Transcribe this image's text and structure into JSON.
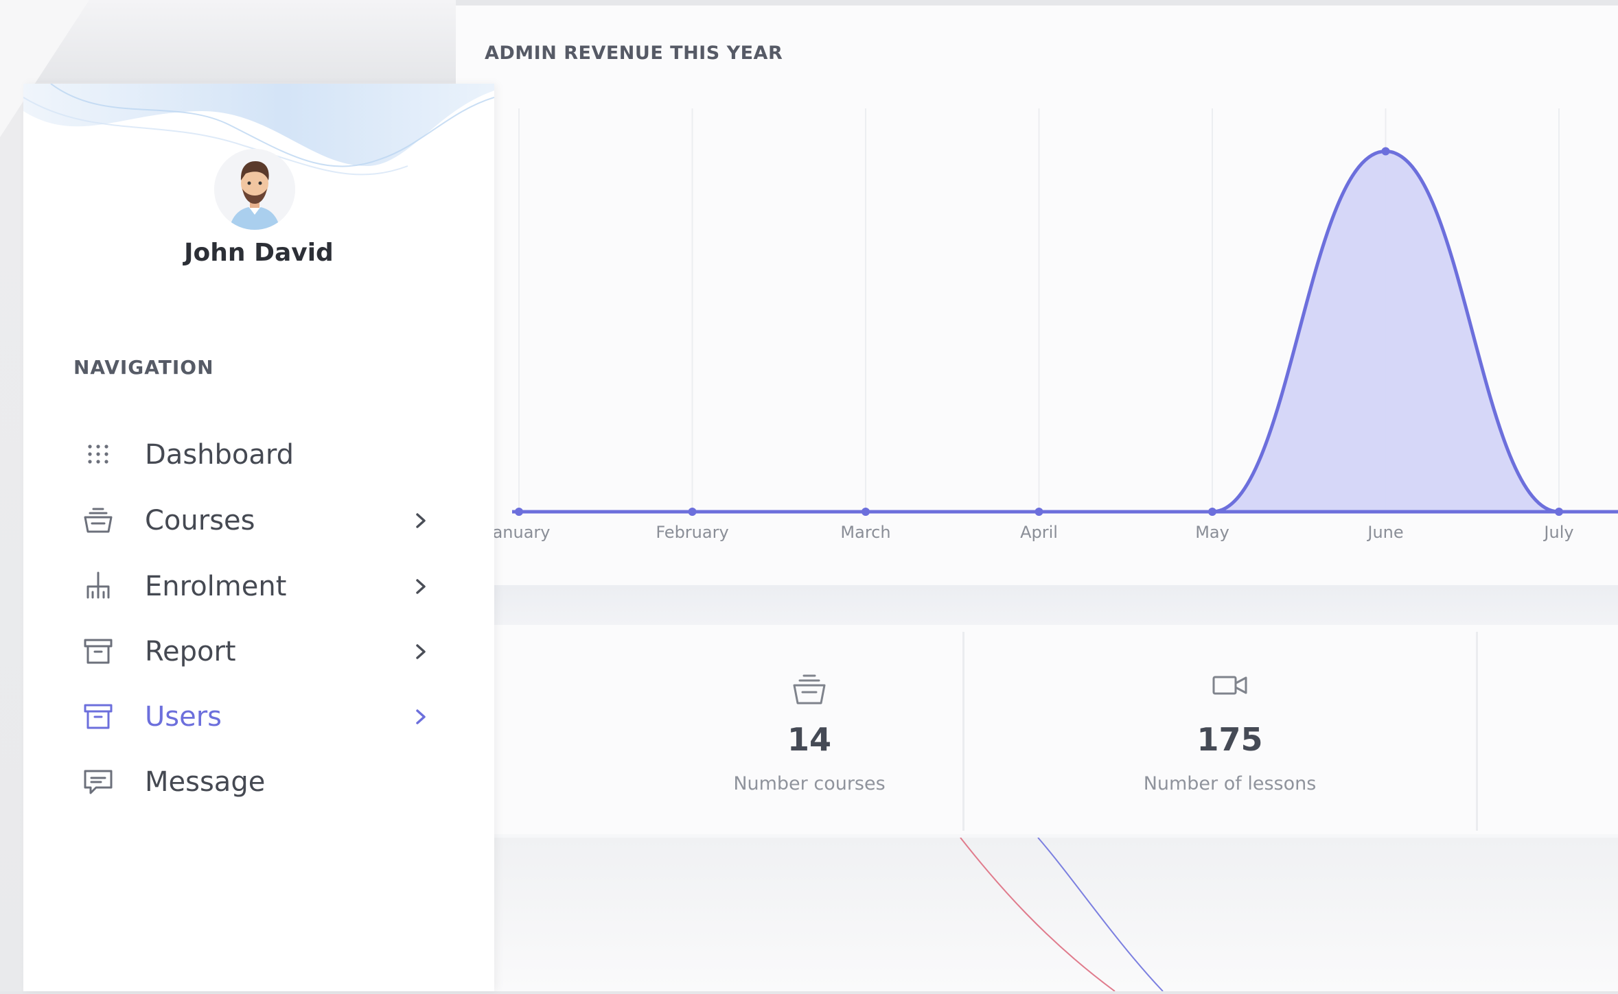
{
  "user": {
    "name": "John David"
  },
  "navigation": {
    "heading": "NAVIGATION",
    "items": [
      {
        "label": "Dashboard",
        "icon": "grid-dots-icon",
        "has_submenu": false,
        "active": false
      },
      {
        "label": "Courses",
        "icon": "basket-icon",
        "has_submenu": true,
        "active": false
      },
      {
        "label": "Enrolment",
        "icon": "hierarchy-icon",
        "has_submenu": true,
        "active": false
      },
      {
        "label": "Report",
        "icon": "archive-icon",
        "has_submenu": true,
        "active": false
      },
      {
        "label": "Users",
        "icon": "archive-icon",
        "has_submenu": true,
        "active": true
      },
      {
        "label": "Message",
        "icon": "message-icon",
        "has_submenu": false,
        "active": false
      }
    ]
  },
  "revenue_card": {
    "title": "ADMIN REVENUE THIS YEAR"
  },
  "chart_data": {
    "type": "area",
    "title": "ADMIN REVENUE THIS YEAR",
    "categories": [
      "January",
      "February",
      "March",
      "April",
      "May",
      "June",
      "July"
    ],
    "series": [
      {
        "values": [
          0,
          0,
          0,
          0,
          0,
          100,
          0
        ]
      }
    ],
    "ylim": [
      0,
      110
    ],
    "grid": "vertical",
    "legend": "none",
    "colors": {
      "line": "#6c6fdc",
      "fill": "#d4d5f8"
    }
  },
  "stats": [
    {
      "value": "14",
      "label": "Number courses",
      "icon": "basket-icon"
    },
    {
      "value": "175",
      "label": "Number of lessons",
      "icon": "video-camera-icon"
    }
  ],
  "colors": {
    "accent": "#6c6fdc",
    "text": "#454952",
    "muted": "#8f939c"
  }
}
